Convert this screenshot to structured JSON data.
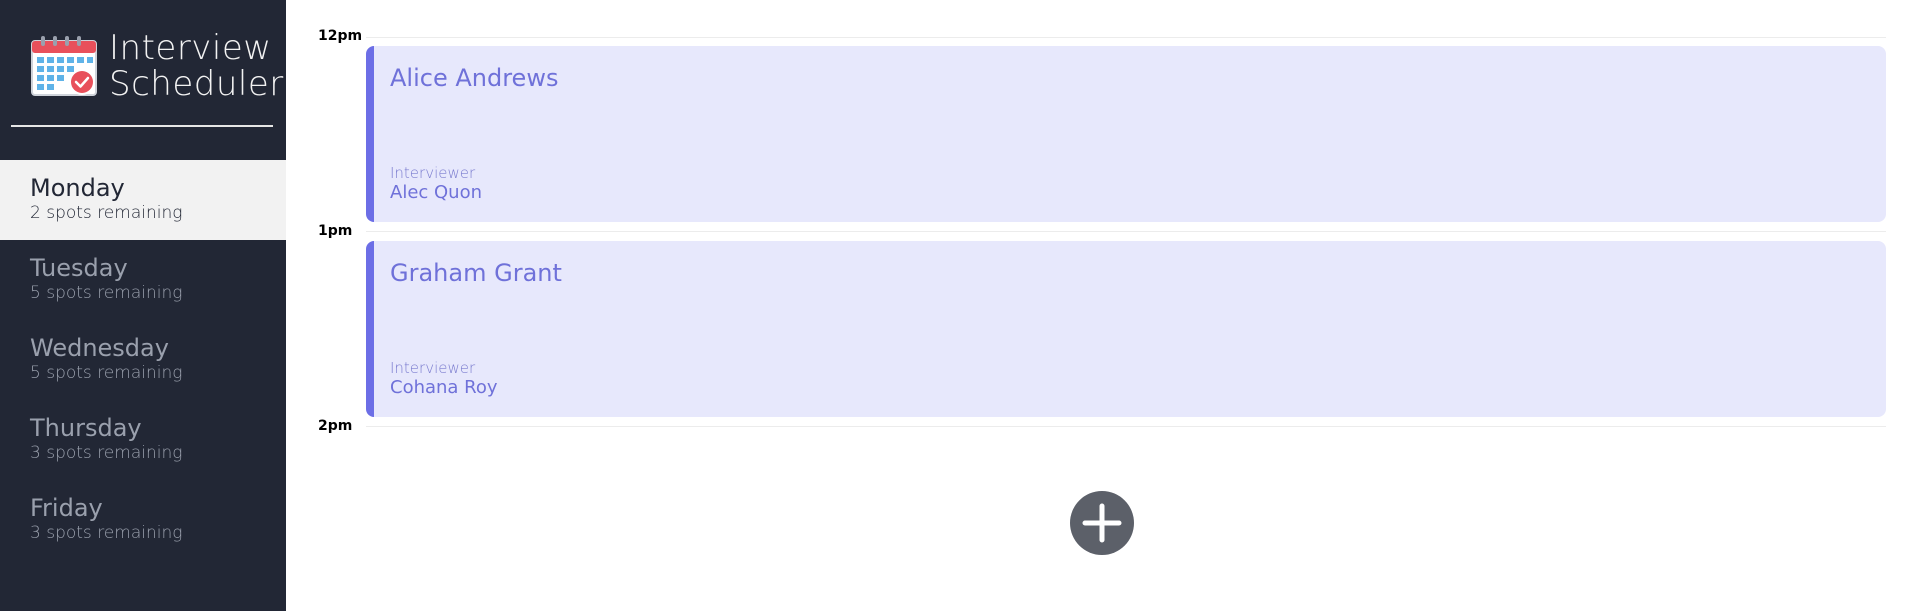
{
  "app": {
    "title_line1": "Interview",
    "title_line2": "Scheduler",
    "logo_icon": "calendar-check-icon"
  },
  "sidebar": {
    "days": [
      {
        "name": "Monday",
        "spots": "2 spots remaining",
        "selected": true
      },
      {
        "name": "Tuesday",
        "spots": "5 spots remaining",
        "selected": false
      },
      {
        "name": "Wednesday",
        "spots": "5 spots remaining",
        "selected": false
      },
      {
        "name": "Thursday",
        "spots": "3 spots remaining",
        "selected": false
      },
      {
        "name": "Friday",
        "spots": "3 spots remaining",
        "selected": false
      }
    ]
  },
  "schedule": {
    "time_slots": [
      "12pm",
      "1pm",
      "2pm"
    ],
    "appointments": [
      {
        "student": "Alice Andrews",
        "interviewer_label": "Interviewer",
        "interviewer": "Alec Quon"
      },
      {
        "student": "Graham Grant",
        "interviewer_label": "Interviewer",
        "interviewer": "Cohana Roy"
      }
    ],
    "add_icon": "plus-icon"
  },
  "colors": {
    "sidebar_bg": "#222735",
    "selected_day_bg": "#f2f2f2",
    "appointment_bg": "#e7e8fc",
    "appointment_accent": "#6c6ee6",
    "add_button_bg": "#5c6069"
  }
}
